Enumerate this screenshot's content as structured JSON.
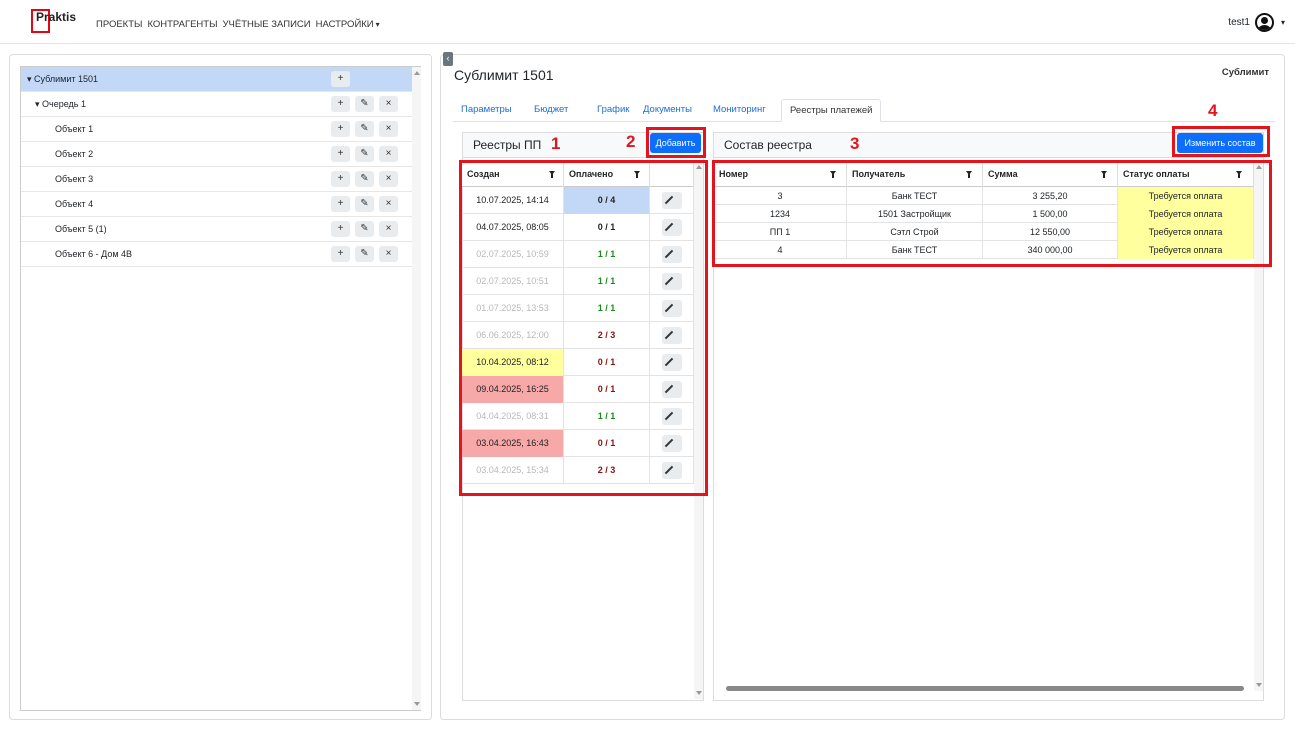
{
  "app": {
    "brand": "Praktis"
  },
  "nav": {
    "items": [
      "ПРОЕКТЫ",
      "КОНТРАГЕНТЫ",
      "УЧЁТНЫЕ ЗАПИСИ",
      "НАСТРОЙКИ"
    ],
    "user": "test1"
  },
  "tree": {
    "root": {
      "label": "Сублимит 1501",
      "actions": [
        "+"
      ]
    },
    "queue": {
      "label": "Очередь 1"
    },
    "objects": [
      "Объект 1",
      "Объект 2",
      "Объект 3",
      "Объект 4",
      "Объект 5 (1)",
      "Объект 6 - Дом 4В"
    ],
    "add_icon": "+",
    "edit_icon": "pencil-icon",
    "delete_icon": "×"
  },
  "page": {
    "title": "Сублимит 1501",
    "right_label": "Сублимит",
    "tabs": [
      "Параметры",
      "Бюджет",
      "График",
      "Документы",
      "Мониторинг",
      "Реестры платежей"
    ],
    "active_tab": "Реестры платежей"
  },
  "registries": {
    "title": "Реестры ПП",
    "add_button": "Добавить",
    "columns": [
      "Создан",
      "Оплачено"
    ],
    "rows": [
      {
        "created": "10.07.2025, 14:14",
        "paid": "0 / 4",
        "style": "selected"
      },
      {
        "created": "04.07.2025, 08:05",
        "paid": "0 / 1",
        "style": "normal"
      },
      {
        "created": "02.07.2025, 10:59",
        "paid": "1 / 1",
        "style": "muted"
      },
      {
        "created": "02.07.2025, 10:51",
        "paid": "1 / 1",
        "style": "muted"
      },
      {
        "created": "01.07.2025, 13:53",
        "paid": "1 / 1",
        "style": "muted"
      },
      {
        "created": "06.06.2025, 12:00",
        "paid": "2 / 3",
        "style": "muted"
      },
      {
        "created": "10.04.2025, 08:12",
        "paid": "0 / 1",
        "style": "yellow"
      },
      {
        "created": "09.04.2025, 16:25",
        "paid": "0 / 1",
        "style": "red"
      },
      {
        "created": "04.04.2025, 08:31",
        "paid": "1 / 1",
        "style": "muted"
      },
      {
        "created": "03.04.2025, 16:43",
        "paid": "0 / 1",
        "style": "red"
      },
      {
        "created": "03.04.2025, 15:34",
        "paid": "2 / 3",
        "style": "muted"
      }
    ]
  },
  "composition": {
    "title": "Состав реестра",
    "change_button": "Изменить состав",
    "columns": [
      "Номер",
      "Получатель",
      "Сумма",
      "Статус оплаты"
    ],
    "rows": [
      {
        "number": "3",
        "recipient": "Банк ТЕСТ",
        "amount": "3 255,20",
        "status": "Требуется оплата"
      },
      {
        "number": "1234",
        "recipient": "1501 Застройщик",
        "amount": "1 500,00",
        "status": "Требуется оплата"
      },
      {
        "number": "ПП 1",
        "recipient": "Сэтл Строй",
        "amount": "12 550,00",
        "status": "Требуется оплата"
      },
      {
        "number": "4",
        "recipient": "Банк ТЕСТ",
        "amount": "340 000,00",
        "status": "Требуется оплата"
      }
    ]
  },
  "annotations": [
    "1",
    "2",
    "3",
    "4"
  ],
  "colors": {
    "primary": "#0d6efd",
    "annotation_red": "#e3141c",
    "selected_row": "#c3d8f7",
    "row_yellow": "#ffff9e",
    "row_red": "#f7a8a8",
    "paid_green": "#1a8a1a",
    "paid_dark_red": "#8b1010"
  }
}
